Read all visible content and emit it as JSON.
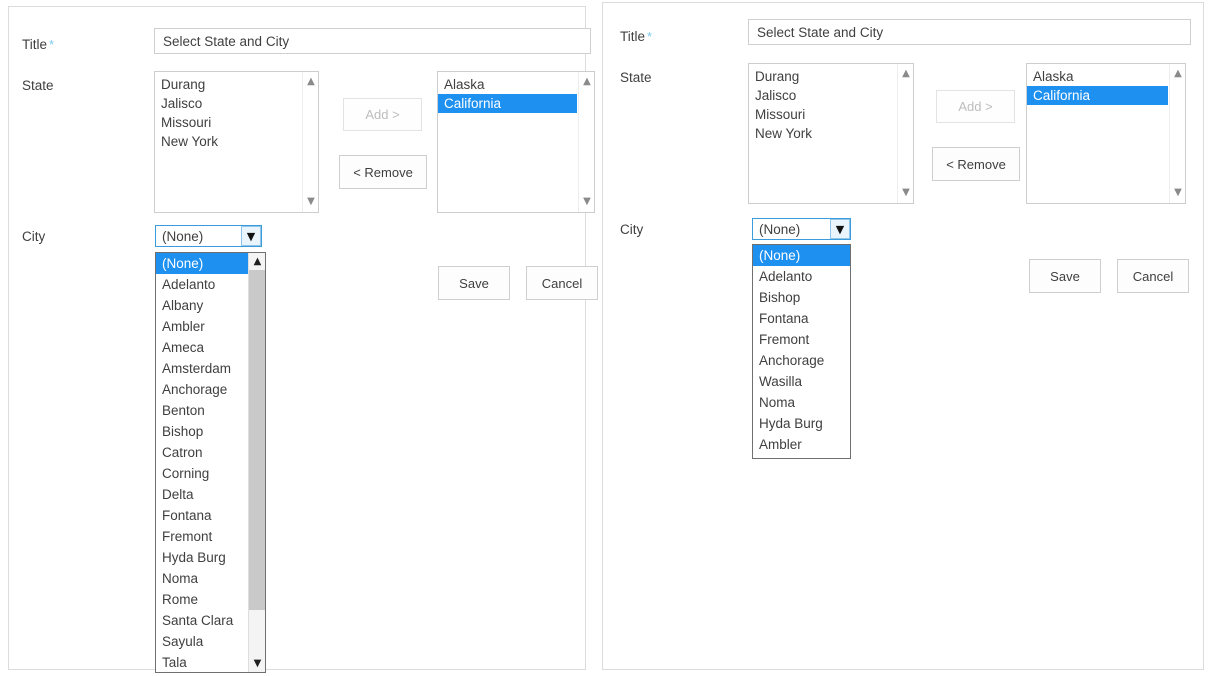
{
  "colors": {
    "selection_blue": "#1e90f0",
    "required_asterisk": "#7ec8ee",
    "combo_focus_border": "#3b9bdd",
    "panel_border": "#dcdcdc",
    "text": "#3f3f3f",
    "disabled_text": "#bdbdbd"
  },
  "panels": [
    {
      "id": "left",
      "title": {
        "label": "Title",
        "required_marker": "*",
        "value": "Select State and City",
        "placeholder": "Select State and City"
      },
      "state": {
        "label": "State",
        "available_items": [
          "Durang",
          "Jalisco",
          "Missouri",
          "New York"
        ],
        "selected_items": [
          "Alaska",
          "California"
        ],
        "selected_highlight": "California",
        "add_button": "Add >",
        "add_button_disabled": true,
        "remove_button": "< Remove"
      },
      "city": {
        "label": "City",
        "selected_value": "(None)",
        "dropdown_open": true,
        "dropdown_has_scrollbar": true,
        "options": [
          "(None)",
          "Adelanto",
          "Albany",
          "Ambler",
          "Ameca",
          "Amsterdam",
          "Anchorage",
          "Benton",
          "Bishop",
          "Catron",
          "Corning",
          "Delta",
          "Fontana",
          "Fremont",
          "Hyda Burg",
          "Noma",
          "Rome",
          "Santa Clara",
          "Sayula",
          "Tala"
        ]
      },
      "actions": {
        "save": "Save",
        "cancel": "Cancel"
      },
      "icons": {
        "scroll_up": "scroll-up-arrow-icon",
        "scroll_down": "scroll-down-arrow-icon",
        "combo_chevron": "chevron-down-icon"
      }
    },
    {
      "id": "right",
      "title": {
        "label": "Title",
        "required_marker": "*",
        "value": "Select State and City",
        "placeholder": "Select State and City"
      },
      "state": {
        "label": "State",
        "available_items": [
          "Durang",
          "Jalisco",
          "Missouri",
          "New York"
        ],
        "selected_items": [
          "Alaska",
          "California"
        ],
        "selected_highlight": "California",
        "add_button": "Add >",
        "add_button_disabled": true,
        "remove_button": "< Remove"
      },
      "city": {
        "label": "City",
        "selected_value": "(None)",
        "dropdown_open": true,
        "dropdown_has_scrollbar": false,
        "options": [
          "(None)",
          "Adelanto",
          "Bishop",
          "Fontana",
          "Fremont",
          "Anchorage",
          "Wasilla",
          "Noma",
          "Hyda Burg",
          "Ambler"
        ]
      },
      "actions": {
        "save": "Save",
        "cancel": "Cancel"
      },
      "icons": {
        "scroll_up": "scroll-up-arrow-icon",
        "scroll_down": "scroll-down-arrow-icon",
        "combo_chevron": "chevron-down-icon"
      }
    }
  ]
}
